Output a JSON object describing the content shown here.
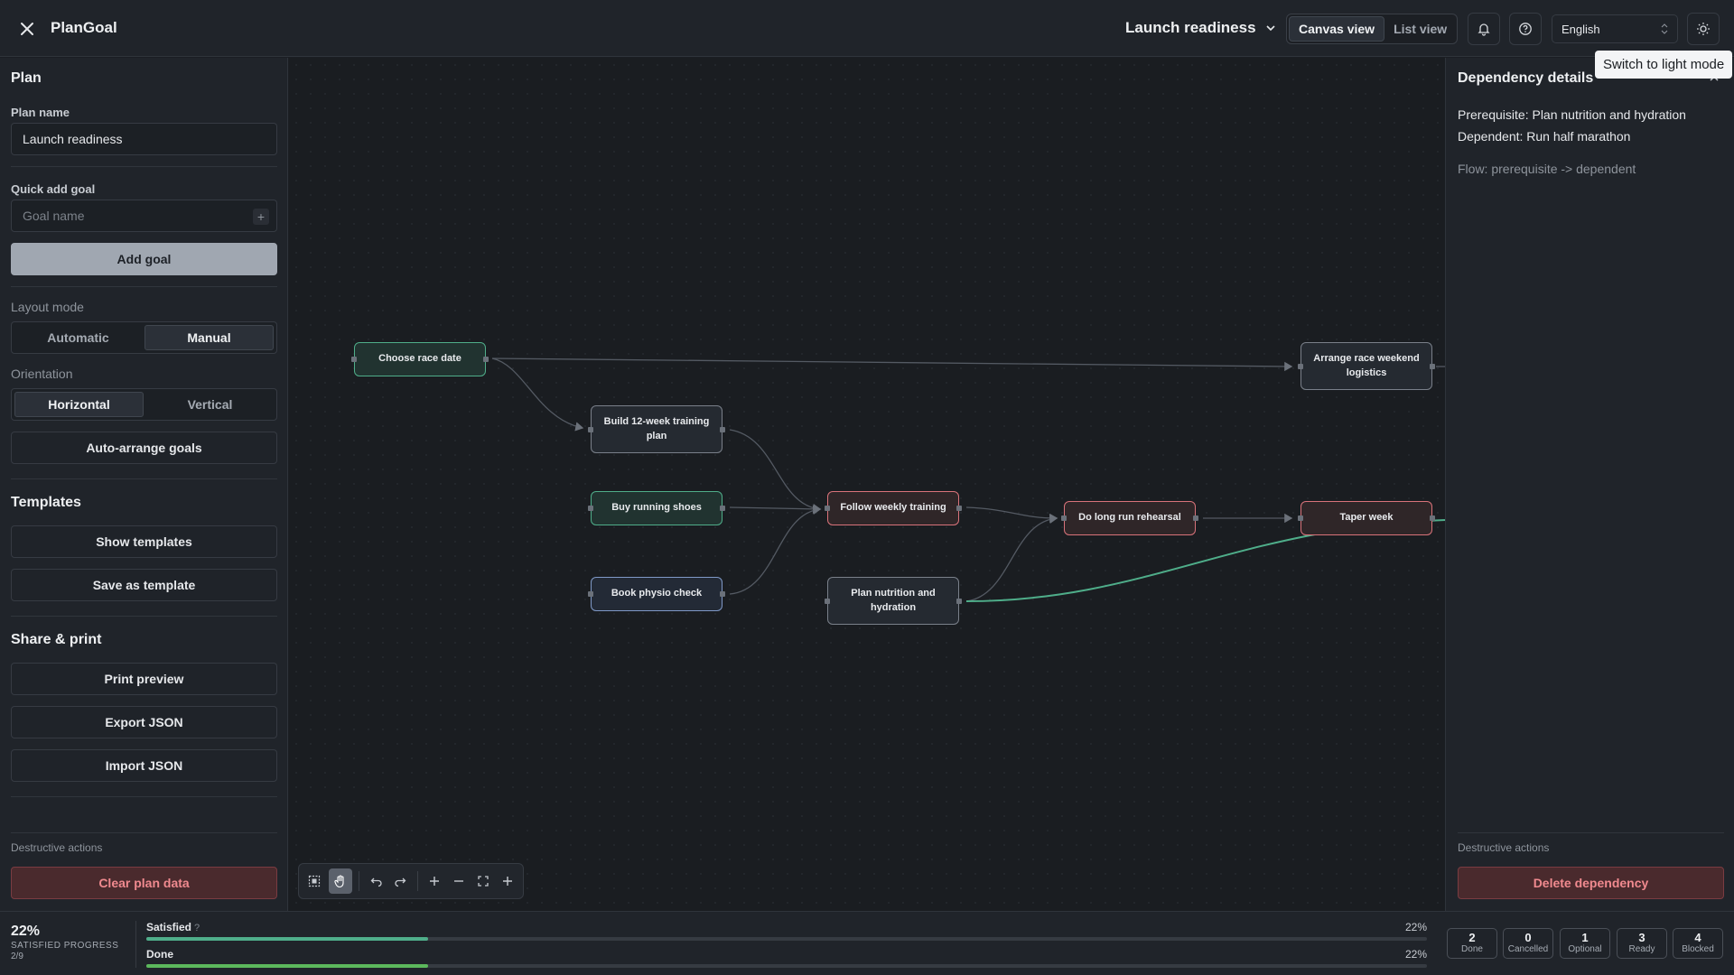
{
  "topbar": {
    "app_title": "PlanGoal",
    "plan_name": "Launch readiness",
    "views": [
      "Canvas view",
      "List view"
    ],
    "active_view": "Canvas view",
    "language": "English",
    "tooltip": "Switch to light mode"
  },
  "sidebar": {
    "plan_heading": "Plan",
    "plan_name_label": "Plan name",
    "plan_name_value": "Launch readiness",
    "quick_add_label": "Quick add goal",
    "goal_placeholder": "Goal name",
    "add_goal_label": "Add goal",
    "layout_mode_label": "Layout mode",
    "layout_modes": [
      "Automatic",
      "Manual"
    ],
    "active_layout_mode": "Manual",
    "orientation_label": "Orientation",
    "orientations": [
      "Horizontal",
      "Vertical"
    ],
    "active_orientation": "Horizontal",
    "auto_arrange_label": "Auto-arrange goals",
    "templates_heading": "Templates",
    "show_templates_label": "Show templates",
    "save_template_label": "Save as template",
    "share_heading": "Share & print",
    "print_preview_label": "Print preview",
    "export_label": "Export JSON",
    "import_label": "Import JSON",
    "destructive_label": "Destructive actions",
    "clear_label": "Clear plan data"
  },
  "canvas": {
    "nodes": [
      {
        "id": "n1",
        "label": "Choose race date",
        "status": "green"
      },
      {
        "id": "n2",
        "label": "Build 12-week training plan",
        "status": "neutral"
      },
      {
        "id": "n3",
        "label": "Buy running shoes",
        "status": "green"
      },
      {
        "id": "n4",
        "label": "Book physio check",
        "status": "blue"
      },
      {
        "id": "n5",
        "label": "Follow weekly training",
        "status": "red"
      },
      {
        "id": "n6",
        "label": "Plan nutrition and hydration",
        "status": "neutral"
      },
      {
        "id": "n7",
        "label": "Do long run rehearsal",
        "status": "red"
      },
      {
        "id": "n8",
        "label": "Arrange race weekend logistics",
        "status": "neutral"
      },
      {
        "id": "n9",
        "label": "Taper week",
        "status": "red"
      }
    ]
  },
  "dependency": {
    "title": "Dependency details",
    "prerequisite": "Prerequisite: Plan nutrition and hydration",
    "dependent": "Dependent: Run half marathon",
    "flow": "Flow: prerequisite -> dependent",
    "destructive_label": "Destructive actions",
    "delete_label": "Delete dependency"
  },
  "progress": {
    "percent_text": "22%",
    "label": "SATISFIED PROGRESS",
    "count": "2/9",
    "bars": [
      {
        "name": "Satisfied",
        "value": 22,
        "value_text": "22%",
        "has_help": true,
        "color": "#4fae8a"
      },
      {
        "name": "Done",
        "value": 22,
        "value_text": "22%",
        "has_help": false,
        "color": "#5cb85c"
      }
    ],
    "help_glyph": "?",
    "stats": [
      {
        "n": "2",
        "label": "Done"
      },
      {
        "n": "0",
        "label": "Cancelled"
      },
      {
        "n": "1",
        "label": "Optional"
      },
      {
        "n": "3",
        "label": "Ready"
      },
      {
        "n": "4",
        "label": "Blocked"
      }
    ]
  },
  "colors": {
    "accent_teal": "#4fae8a",
    "status_red": "#d9737a",
    "status_blue": "#7f99c7",
    "danger": "#f08a8f"
  }
}
